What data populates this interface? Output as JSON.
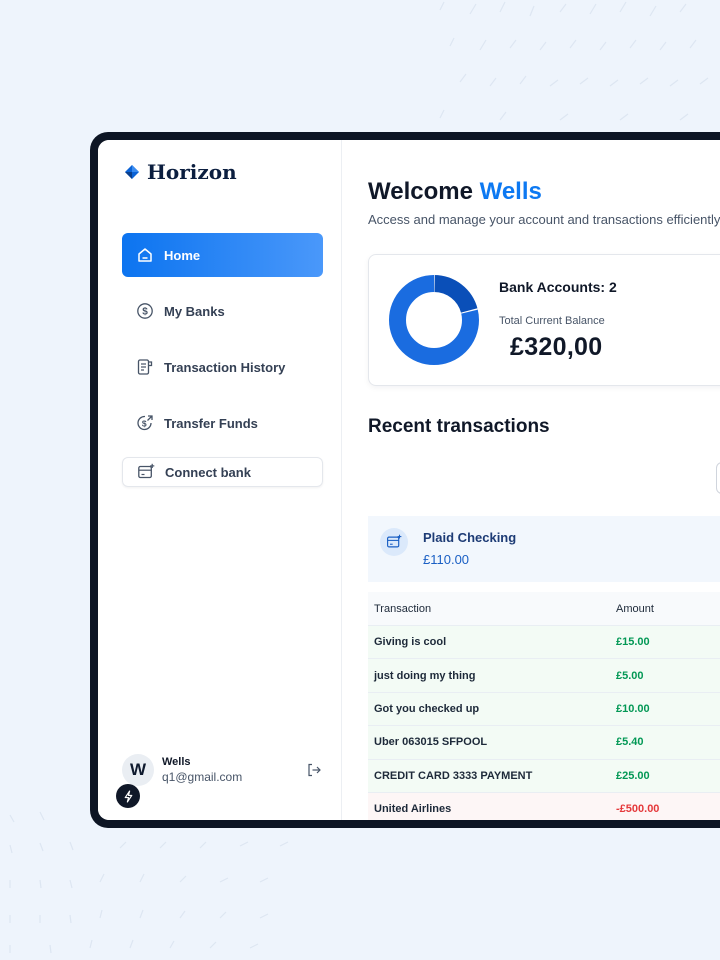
{
  "app": {
    "name": "Horizon"
  },
  "sidebar": {
    "items": [
      {
        "label": "Home",
        "icon": "home-icon",
        "active": true
      },
      {
        "label": "My Banks",
        "icon": "dollar-circle-icon"
      },
      {
        "label": "Transaction History",
        "icon": "receipt-icon"
      },
      {
        "label": "Transfer Funds",
        "icon": "money-send-icon"
      }
    ],
    "connect_bank": {
      "label": "Connect bank",
      "icon": "card-add-icon"
    },
    "user": {
      "initial": "W",
      "name": "Wells",
      "email": "q1@gmail.com"
    }
  },
  "main": {
    "welcome_prefix": "Welcome",
    "welcome_name": "Wells",
    "subtitle": "Access and manage your account and transactions efficiently.",
    "balance": {
      "accounts_label": "Bank Accounts: 2",
      "total_label": "Total Current Balance",
      "total_value": "£320,00",
      "donut_shares": [
        0.21,
        0.79
      ]
    },
    "recent_title": "Recent transactions",
    "bank": {
      "name": "Plaid Checking",
      "amount": "£110.00"
    },
    "table": {
      "headers": {
        "transaction": "Transaction",
        "amount": "Amount"
      },
      "rows": [
        {
          "name": "Giving is cool",
          "amount": "£15.00",
          "type": "pos"
        },
        {
          "name": "just doing my thing",
          "amount": "£5.00",
          "type": "pos"
        },
        {
          "name": "Got you checked up",
          "amount": "£10.00",
          "type": "pos"
        },
        {
          "name": "Uber 063015 SFPOOL",
          "amount": "£5.40",
          "type": "pos"
        },
        {
          "name": "CREDIT CARD 3333 PAYMENT",
          "amount": "£25.00",
          "type": "pos"
        },
        {
          "name": "United Airlines",
          "amount": "-£500.00",
          "type": "neg"
        }
      ]
    }
  },
  "colors": {
    "accent": "#0d79f2",
    "positive": "#039855",
    "negative": "#e5393b",
    "donut_dark": "#0a4fb8",
    "donut_light": "#1a6ce0"
  }
}
